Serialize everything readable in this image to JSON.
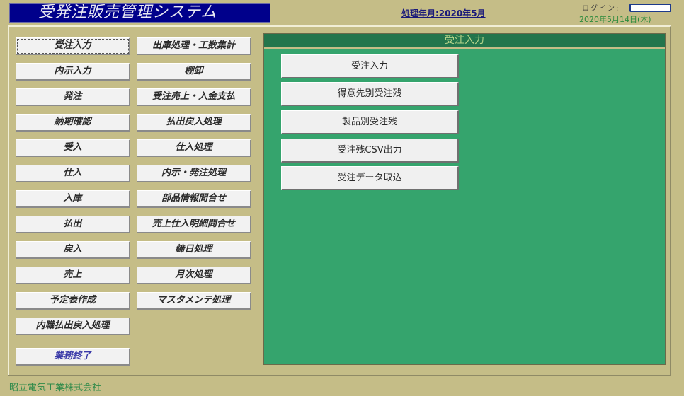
{
  "header": {
    "app_title": "受発注販売管理システム",
    "processing_month": "処理年月:2020年5月",
    "login_label": "ログイン:",
    "login_value": "",
    "current_date": "2020年5月14日(木)"
  },
  "menu": {
    "left": [
      {
        "label": "受注入力",
        "focused": true
      },
      {
        "label": "内示入力"
      },
      {
        "label": "発注"
      },
      {
        "label": "納期確認"
      },
      {
        "label": "受入"
      },
      {
        "label": "仕入"
      },
      {
        "label": "入庫"
      },
      {
        "label": "払出"
      },
      {
        "label": "戻入"
      },
      {
        "label": "売上"
      },
      {
        "label": "予定表作成"
      },
      {
        "label": "内職払出戻入処理"
      }
    ],
    "right": [
      {
        "label": "出庫処理・工数集計"
      },
      {
        "label": "棚卸"
      },
      {
        "label": "受注売上・入金支払"
      },
      {
        "label": "払出戻入処理"
      },
      {
        "label": "仕入処理"
      },
      {
        "label": "内示・発注処理"
      },
      {
        "label": "部品情報問合せ"
      },
      {
        "label": "売上仕入明細問合せ"
      },
      {
        "label": "締日処理"
      },
      {
        "label": "月次処理"
      },
      {
        "label": "マスタメンテ処理"
      }
    ],
    "exit_label": "業務終了"
  },
  "panel": {
    "title": "受注入力",
    "buttons": [
      {
        "label": "受注入力"
      },
      {
        "label": "得意先別受注残"
      },
      {
        "label": "製品別受注残"
      },
      {
        "label": "受注残CSV出力"
      },
      {
        "label": "受注データ取込"
      }
    ]
  },
  "footer": {
    "company": "昭立電気工業株式会社"
  },
  "colors": {
    "background": "#c5bd87",
    "title_bar": "#00008b",
    "panel_green": "#35a46d",
    "panel_header": "#23754c",
    "date_text": "#2c8a3c",
    "exit_text": "#3a3aa8"
  }
}
